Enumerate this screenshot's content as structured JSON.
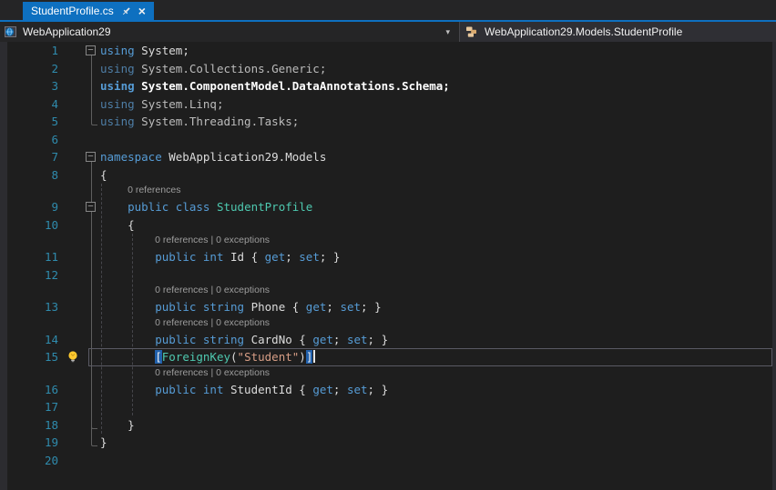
{
  "tab_bar": {
    "active_tab": "StudentProfile.cs"
  },
  "icons": {
    "fold_collapse": "–",
    "dropdown_chevron": "▾",
    "close": "×",
    "pin": "pin-icon",
    "project": "web-project-icon",
    "class": "class-icon",
    "lightbulb": "quick-actions-lightbulb-icon"
  },
  "navigation_bar": {
    "project_dropdown": "WebApplication29",
    "member_dropdown": "WebApplication29.Models.StudentProfile"
  },
  "colors": {
    "accent_blue": "#0e70c0",
    "editor_background": "#1e1e1e",
    "keyword": "#569cd6",
    "type_name": "#4ec9b0",
    "string_literal": "#d69d85",
    "line_number": "#2f8bad",
    "codelens_text": "#9d9d9d",
    "bracket_match_background": "#2160ab"
  },
  "editor": {
    "codelens_reference_label": "0 references",
    "codelens_full_label": "0 references | 0 exceptions",
    "rows": [
      {
        "kind": "code",
        "num": "1",
        "outline": [
          "box",
          "vb"
        ],
        "tokens": [
          [
            "kw",
            "using"
          ],
          [
            "pl",
            " System;"
          ]
        ]
      },
      {
        "kind": "code",
        "num": "2",
        "outline": [
          "v"
        ],
        "tokens": [
          [
            "kwd",
            "using"
          ],
          [
            "dim",
            " System.Collections.Generic;"
          ]
        ]
      },
      {
        "kind": "code",
        "num": "3",
        "outline": [
          "v"
        ],
        "tokens": [
          [
            "kwb",
            "using"
          ],
          [
            "bold",
            " System.ComponentModel.DataAnnotations.Schema;"
          ]
        ]
      },
      {
        "kind": "code",
        "num": "4",
        "outline": [
          "v"
        ],
        "tokens": [
          [
            "kwd",
            "using"
          ],
          [
            "dim",
            " System.Linq;"
          ]
        ]
      },
      {
        "kind": "code",
        "num": "5",
        "outline": [
          "end"
        ],
        "tokens": [
          [
            "kwd",
            "using"
          ],
          [
            "dim",
            " System.Threading.Tasks;"
          ]
        ]
      },
      {
        "kind": "code",
        "num": "6",
        "outline": [],
        "tokens": []
      },
      {
        "kind": "code",
        "num": "7",
        "outline": [
          "box",
          "vb"
        ],
        "tokens": [
          [
            "kw",
            "namespace"
          ],
          [
            "pl",
            " WebApplication29.Models"
          ]
        ]
      },
      {
        "kind": "code",
        "num": "8",
        "outline": [
          "v"
        ],
        "tokens": [
          [
            "pl",
            "{"
          ]
        ]
      },
      {
        "kind": "lens",
        "indent": 4,
        "outline": [
          "v"
        ],
        "text": "0 references"
      },
      {
        "kind": "code",
        "num": "9",
        "outline": [
          "box",
          "v"
        ],
        "tokens": [
          [
            "pl",
            "    "
          ],
          [
            "kw",
            "public"
          ],
          [
            "pl",
            " "
          ],
          [
            "kw",
            "class"
          ],
          [
            "pl",
            " "
          ],
          [
            "type",
            "StudentProfile"
          ]
        ]
      },
      {
        "kind": "code",
        "num": "10",
        "outline": [
          "v"
        ],
        "tokens": [
          [
            "pl",
            "    {"
          ]
        ]
      },
      {
        "kind": "lens",
        "indent": 8,
        "outline": [
          "v"
        ],
        "text": "0 references | 0 exceptions"
      },
      {
        "kind": "code",
        "num": "11",
        "outline": [
          "v"
        ],
        "tokens": [
          [
            "pl",
            "        "
          ],
          [
            "kw",
            "public"
          ],
          [
            "pl",
            " "
          ],
          [
            "kw",
            "int"
          ],
          [
            "pl",
            " Id { "
          ],
          [
            "kw",
            "get"
          ],
          [
            "pl",
            "; "
          ],
          [
            "kw",
            "set"
          ],
          [
            "pl",
            "; }"
          ]
        ]
      },
      {
        "kind": "code",
        "num": "12",
        "outline": [
          "v"
        ],
        "tokens": []
      },
      {
        "kind": "lens",
        "indent": 8,
        "outline": [
          "v"
        ],
        "text": "0 references | 0 exceptions"
      },
      {
        "kind": "code",
        "num": "13",
        "outline": [
          "v"
        ],
        "tokens": [
          [
            "pl",
            "        "
          ],
          [
            "kw",
            "public"
          ],
          [
            "pl",
            " "
          ],
          [
            "kw",
            "string"
          ],
          [
            "pl",
            " Phone { "
          ],
          [
            "kw",
            "get"
          ],
          [
            "pl",
            "; "
          ],
          [
            "kw",
            "set"
          ],
          [
            "pl",
            "; }"
          ]
        ]
      },
      {
        "kind": "lens",
        "indent": 8,
        "outline": [
          "v"
        ],
        "text": "0 references | 0 exceptions"
      },
      {
        "kind": "code",
        "num": "14",
        "outline": [
          "v"
        ],
        "tokens": [
          [
            "pl",
            "        "
          ],
          [
            "kw",
            "public"
          ],
          [
            "pl",
            " "
          ],
          [
            "kw",
            "string"
          ],
          [
            "pl",
            " CardNo { "
          ],
          [
            "kw",
            "get"
          ],
          [
            "pl",
            "; "
          ],
          [
            "kw",
            "set"
          ],
          [
            "pl",
            "; }"
          ]
        ]
      },
      {
        "kind": "code",
        "num": "15",
        "outline": [
          "v"
        ],
        "bulb": true,
        "current": true,
        "caret": true,
        "tokens": [
          [
            "pl",
            "        "
          ],
          [
            "bh",
            "["
          ],
          [
            "type",
            "ForeignKey"
          ],
          [
            "pl",
            "("
          ],
          [
            "str",
            "\"Student\""
          ],
          [
            "pl",
            ")"
          ],
          [
            "bh",
            "]"
          ]
        ]
      },
      {
        "kind": "lens",
        "indent": 8,
        "outline": [
          "v"
        ],
        "text": "0 references | 0 exceptions"
      },
      {
        "kind": "code",
        "num": "16",
        "outline": [
          "v"
        ],
        "tokens": [
          [
            "pl",
            "        "
          ],
          [
            "kw",
            "public"
          ],
          [
            "pl",
            " "
          ],
          [
            "kw",
            "int"
          ],
          [
            "pl",
            " StudentId { "
          ],
          [
            "kw",
            "get"
          ],
          [
            "pl",
            "; "
          ],
          [
            "kw",
            "set"
          ],
          [
            "pl",
            "; }"
          ]
        ]
      },
      {
        "kind": "code",
        "num": "17",
        "outline": [
          "v"
        ],
        "tokens": []
      },
      {
        "kind": "code",
        "num": "18",
        "outline": [
          "v",
          "end"
        ],
        "tokens": [
          [
            "pl",
            "    }"
          ]
        ]
      },
      {
        "kind": "code",
        "num": "19",
        "outline": [
          "end"
        ],
        "tokens": [
          [
            "pl",
            "}"
          ]
        ]
      },
      {
        "kind": "code",
        "num": "20",
        "outline": [],
        "tokens": []
      }
    ]
  }
}
